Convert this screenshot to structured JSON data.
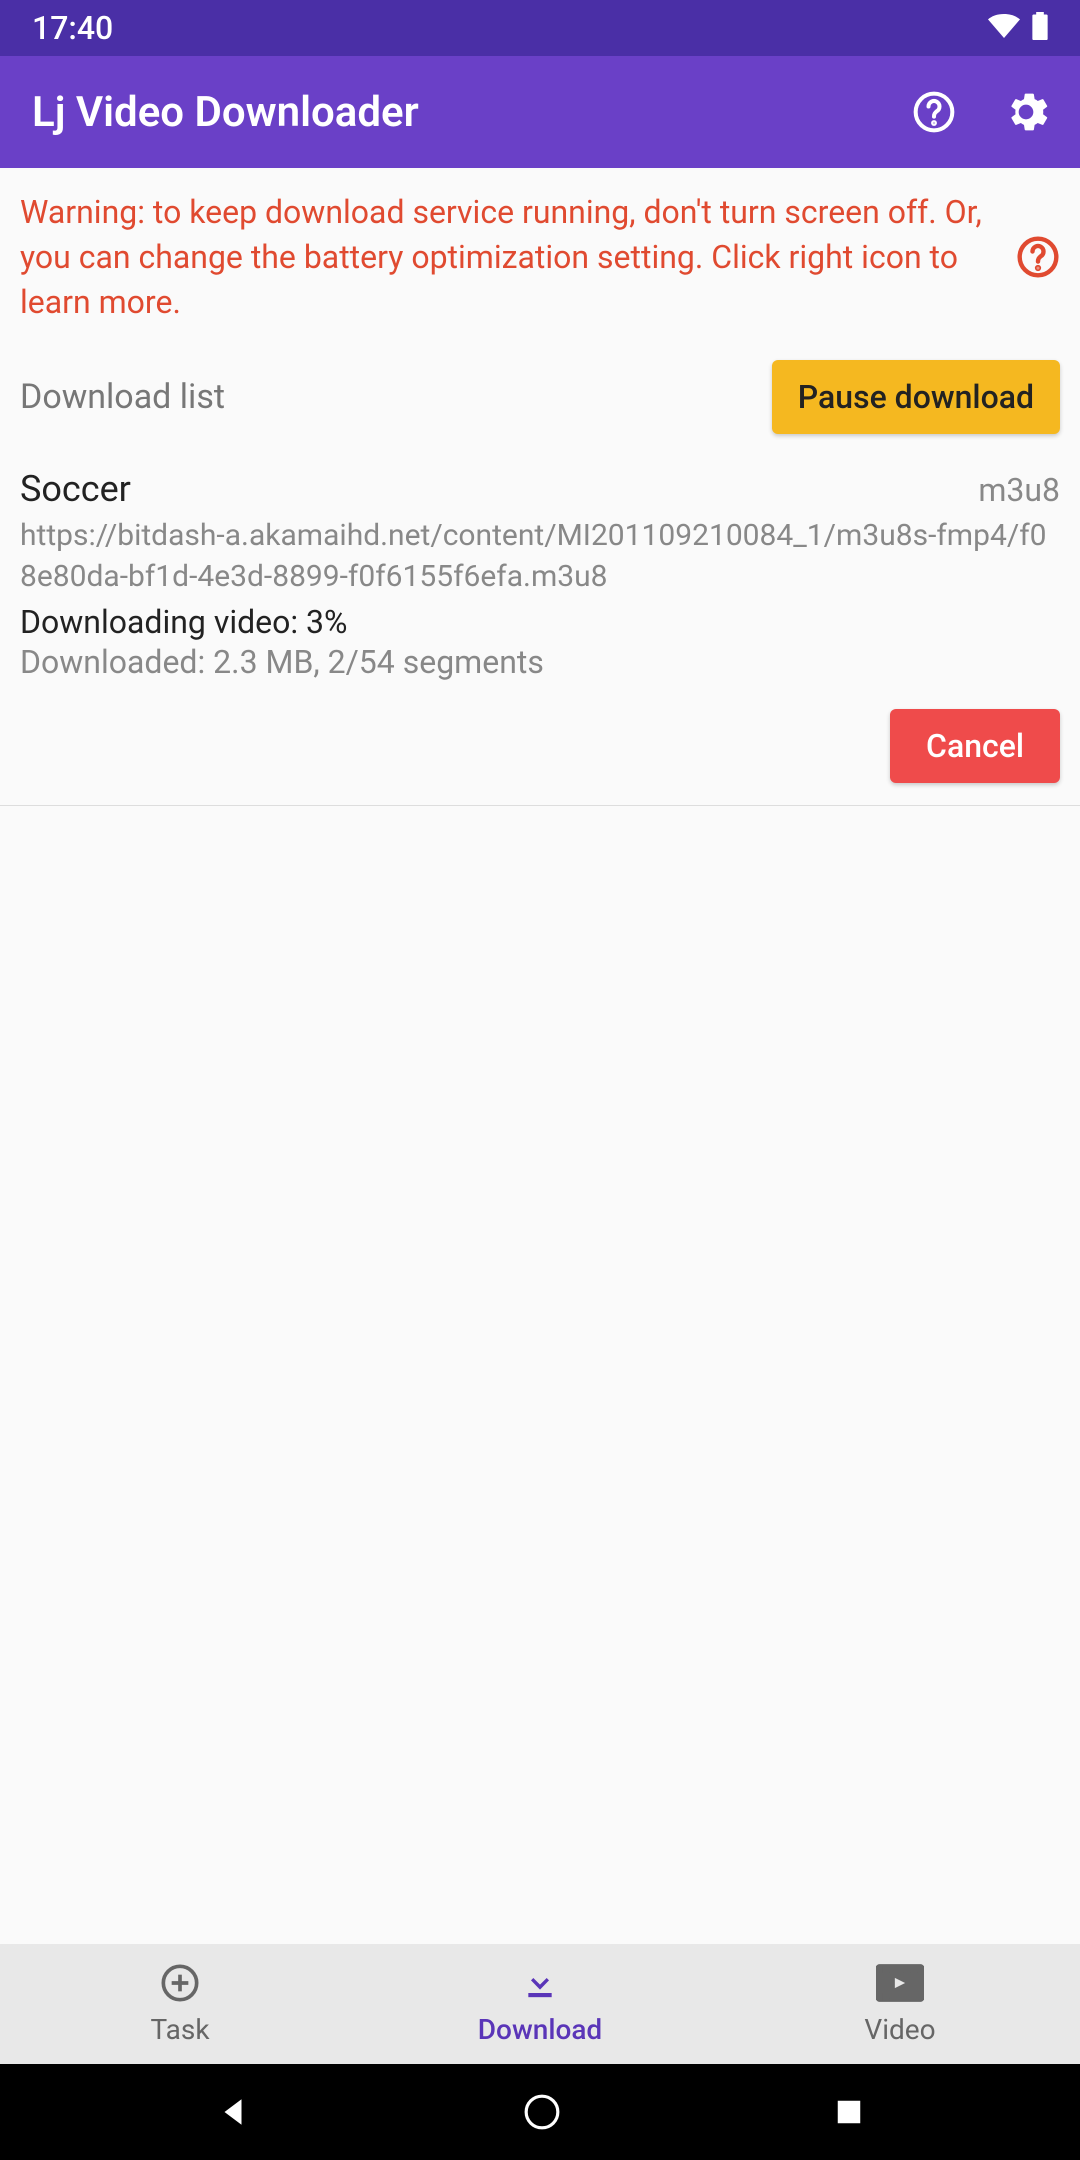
{
  "status": {
    "time": "17:40"
  },
  "header": {
    "title": "Lj Video Downloader"
  },
  "warning": {
    "text": "Warning: to keep download service running, don't turn screen off. Or, you can change the battery optimization setting. Click right icon to learn more."
  },
  "list": {
    "title": "Download list",
    "pause_label": "Pause download"
  },
  "download": {
    "title": "Soccer",
    "format": "m3u8",
    "url": "https://bitdash-a.akamaihd.net/content/MI201109210084_1/m3u8s-fmp4/f08e80da-bf1d-4e3d-8899-f0f6155f6efa.m3u8",
    "progress": "Downloading video: 3%",
    "stats": "Downloaded: 2.3 MB, 2/54 segments",
    "cancel_label": "Cancel"
  },
  "nav": {
    "task": "Task",
    "download": "Download",
    "video": "Video"
  }
}
